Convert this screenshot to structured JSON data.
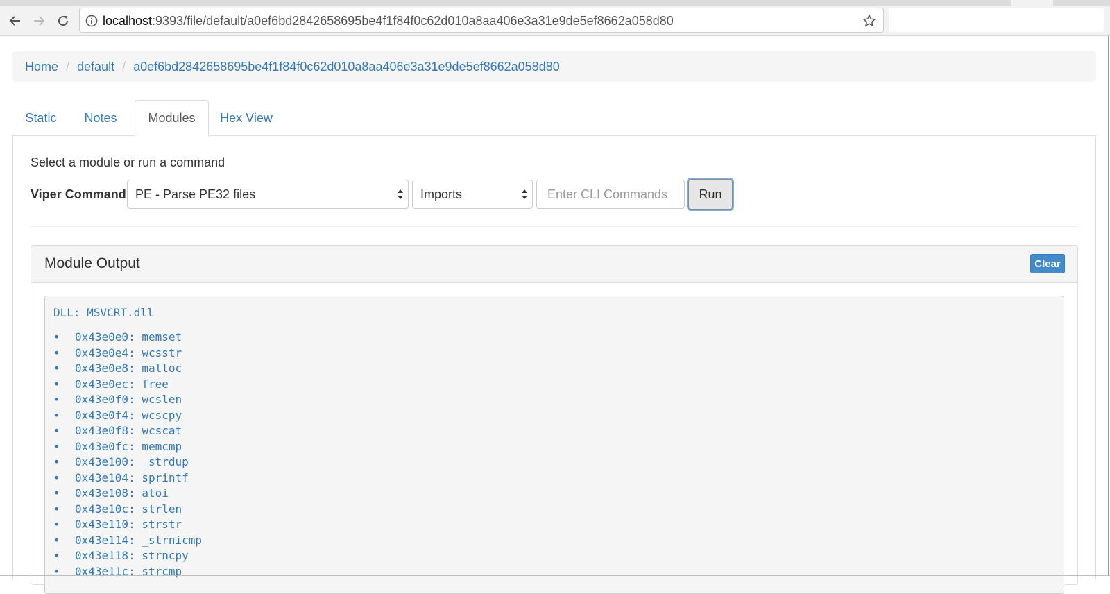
{
  "browser": {
    "url_host": "localhost",
    "url_path": ":9393/file/default/a0ef6bd2842658695be4f1f84f0c62d010a8aa406e3a31e9de5ef8662a058d80"
  },
  "breadcrumb": {
    "items": [
      "Home",
      "default",
      "a0ef6bd2842658695be4f1f84f0c62d010a8aa406e3a31e9de5ef8662a058d80"
    ],
    "separator": "/"
  },
  "tabs": [
    {
      "label": "Static"
    },
    {
      "label": "Notes"
    },
    {
      "label": "Modules"
    },
    {
      "label": "Hex View"
    }
  ],
  "modules": {
    "prompt": "Select a module or run a command",
    "command_label": "Viper Command",
    "module_select": "PE - Parse PE32 files",
    "submodule_select": "Imports",
    "cli_placeholder": "Enter CLI Commands",
    "run_label": "Run"
  },
  "output": {
    "title": "Module Output",
    "clear_label": "Clear",
    "dll": "DLL: MSVCRT.dll",
    "bullet": "•",
    "imports": [
      "0x43e0e0: memset",
      "0x43e0e4: wcsstr",
      "0x43e0e8: malloc",
      "0x43e0ec: free",
      "0x43e0f0: wcslen",
      "0x43e0f4: wcscpy",
      "0x43e0f8: wcscat",
      "0x43e0fc: memcmp",
      "0x43e100: _strdup",
      "0x43e104: sprintf",
      "0x43e108: atoi",
      "0x43e10c: strlen",
      "0x43e110: strstr",
      "0x43e114: _strnicmp",
      "0x43e118: strncpy",
      "0x43e11c: strcmp"
    ]
  },
  "colors": {
    "link": "#337ab7",
    "clear_button": "#428bca",
    "panel_bg": "#f5f5f5"
  }
}
